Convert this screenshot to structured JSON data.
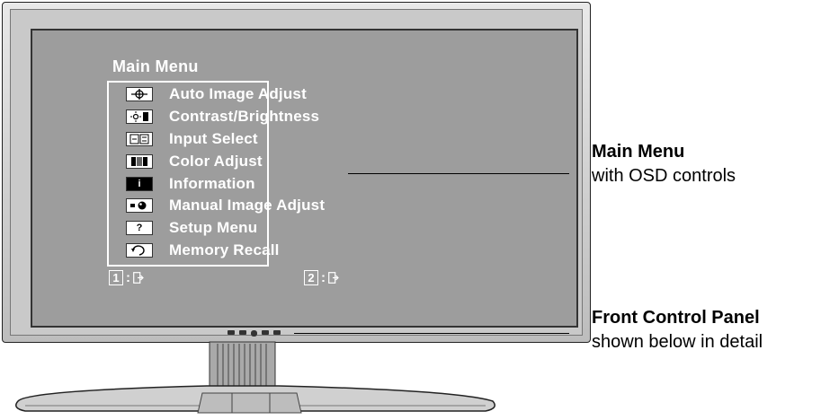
{
  "osd": {
    "title": "Main Menu",
    "items": [
      {
        "label": "Auto Image Adjust",
        "icon": "crosshair-icon"
      },
      {
        "label": "Contrast/Brightness",
        "icon": "brightness-icon"
      },
      {
        "label": "Input Select",
        "icon": "input-select-icon"
      },
      {
        "label": "Color Adjust",
        "icon": "color-bars-icon"
      },
      {
        "label": "Information",
        "icon": "info-icon",
        "glyph": "i"
      },
      {
        "label": "Manual Image Adjust",
        "icon": "manual-adjust-icon"
      },
      {
        "label": "Setup Menu",
        "icon": "question-icon",
        "glyph": "?"
      },
      {
        "label": "Memory Recall",
        "icon": "memory-recall-icon"
      }
    ],
    "key1": "1",
    "key2": "2",
    "separator": ":"
  },
  "callouts": {
    "main_menu_title": "Main Menu",
    "main_menu_desc": "with OSD controls",
    "panel_title": "Front Control Panel",
    "panel_desc": "shown below in detail"
  }
}
